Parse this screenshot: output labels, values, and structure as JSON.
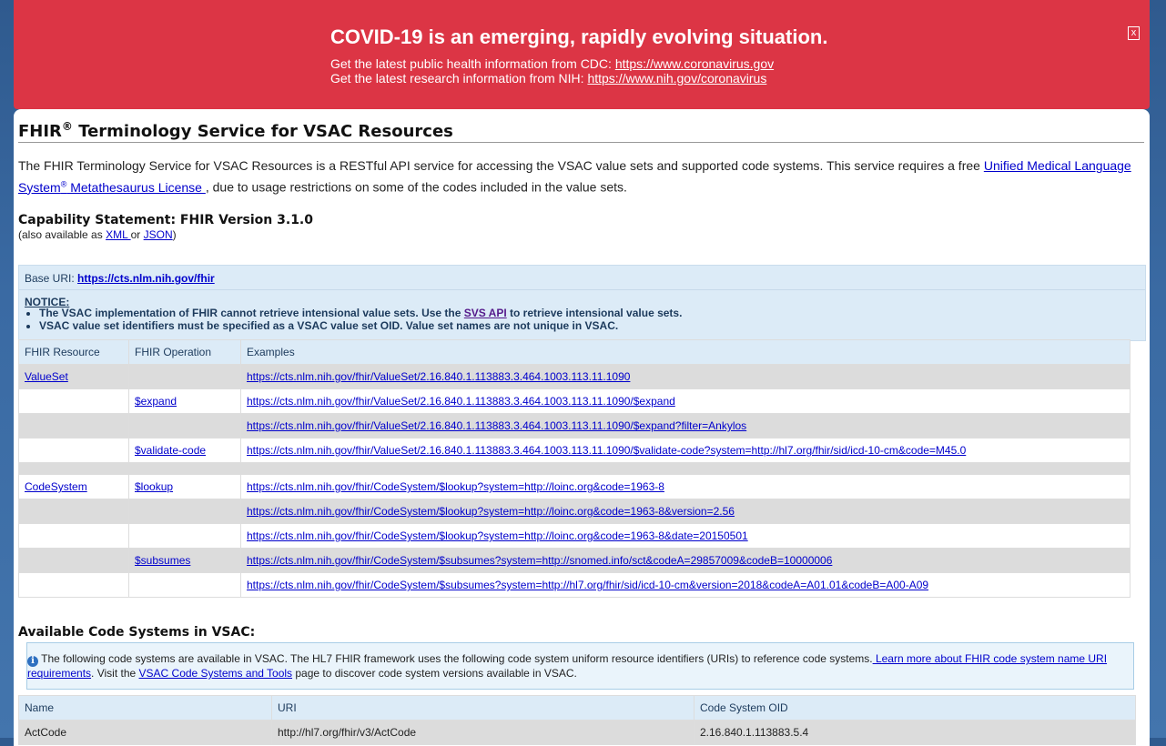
{
  "banner": {
    "title": "COVID-19 is an emerging, rapidly evolving situation.",
    "line1_text": "Get the latest public health information from CDC: ",
    "line1_link": "https://www.coronavirus.gov",
    "line2_text": "Get the latest research information from NIH: ",
    "line2_link": "https://www.nih.gov/coronavirus",
    "close_label": "x"
  },
  "page": {
    "title": "FHIR",
    "title_sup": "®",
    "title_rest": " Terminology Service for VSAC Resources",
    "intro_text": "The FHIR Terminology Service for VSAC Resources is a RESTful API service for accessing the VSAC value sets and supported code systems. This service requires a free ",
    "intro_link1": "Unified Medical Language System",
    "intro_link_sup": "®",
    "intro_link2": " Metathesaurus License ",
    "intro_tail": ", due to usage restrictions on some of the codes included in the value sets."
  },
  "capability": {
    "title": "Capability Statement: FHIR Version 3.1.0",
    "sub_prefix": "(also available as ",
    "xml_link": "XML ",
    "sub_or": "or ",
    "json_link": "JSON",
    "sub_suffix": ")"
  },
  "notice_box": {
    "base_label": "Base URI: ",
    "base_link": "https://cts.nlm.nih.gov/fhir",
    "notice_label": "NOTICE:",
    "bullet1_pre": "The VSAC implementation of FHIR cannot retrieve intensional value sets. Use the ",
    "bullet1_link": "SVS API",
    "bullet1_post": " to retrieve intensional value sets.",
    "bullet2": "VSAC value set identifiers must be specified as a VSAC value set OID. Value set names are not unique in VSAC."
  },
  "fhir_table": {
    "headers": [
      "FHIR Resource",
      "FHIR Operation",
      "Examples"
    ],
    "rows": [
      {
        "resource": "ValueSet",
        "operation": "",
        "example": "https://cts.nlm.nih.gov/fhir/ValueSet/2.16.840.1.113883.3.464.1003.113.11.1090"
      },
      {
        "resource": "",
        "operation": "$expand",
        "example": "https://cts.nlm.nih.gov/fhir/ValueSet/2.16.840.1.113883.3.464.1003.113.11.1090/$expand"
      },
      {
        "resource": "",
        "operation": "",
        "example": "https://cts.nlm.nih.gov/fhir/ValueSet/2.16.840.1.113883.3.464.1003.113.11.1090/$expand?filter=Ankylos"
      },
      {
        "resource": "",
        "operation": "$validate-code",
        "example": "https://cts.nlm.nih.gov/fhir/ValueSet/2.16.840.1.113883.3.464.1003.113.11.1090/$validate-code?system=http://hl7.org/fhir/sid/icd-10-cm&code=M45.0"
      },
      {
        "resource": "CodeSystem",
        "operation": "$lookup",
        "example": "https://cts.nlm.nih.gov/fhir/CodeSystem/$lookup?system=http://loinc.org&code=1963-8"
      },
      {
        "resource": "",
        "operation": "",
        "example": "https://cts.nlm.nih.gov/fhir/CodeSystem/$lookup?system=http://loinc.org&code=1963-8&version=2.56"
      },
      {
        "resource": "",
        "operation": "",
        "example": "https://cts.nlm.nih.gov/fhir/CodeSystem/$lookup?system=http://loinc.org&code=1963-8&date=20150501"
      },
      {
        "resource": "",
        "operation": "$subsumes",
        "example": "https://cts.nlm.nih.gov/fhir/CodeSystem/$subsumes?system=http://snomed.info/sct&codeA=29857009&codeB=10000006"
      },
      {
        "resource": "",
        "operation": "",
        "example": "https://cts.nlm.nih.gov/fhir/CodeSystem/$subsumes?system=http://hl7.org/fhir/sid/icd-10-cm&version=2018&codeA=A01.01&codeB=A00-A09"
      }
    ]
  },
  "code_systems": {
    "title": "Available Code Systems in VSAC:",
    "info_icon": "info-icon",
    "info_text": " The following code systems are available in VSAC. The HL7 FHIR framework uses the following code system uniform resource identifiers (URIs) to reference code systems.",
    "info_link1": " Learn more about FHIR code system name URI requirements",
    "info_mid": ". Visit the ",
    "info_link2": "VSAC Code Systems and Tools",
    "info_tail": " page to discover code system versions available in VSAC.",
    "headers": [
      "Name",
      "URI",
      "Code System OID"
    ],
    "rows": [
      {
        "name": "ActCode",
        "uri": "http://hl7.org/fhir/v3/ActCode",
        "oid": "2.16.840.1.113883.5.4"
      }
    ]
  }
}
